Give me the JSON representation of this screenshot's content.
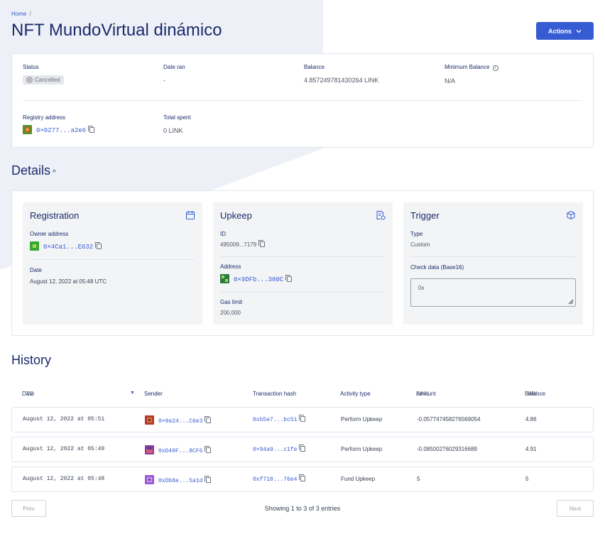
{
  "breadcrumb": {
    "home": "Home",
    "sep": "/"
  },
  "page": {
    "title": "NFT MundoVirtual dinámico"
  },
  "actions": {
    "label": "Actions"
  },
  "summary": {
    "status_label": "Status",
    "status_value": "Cancelled",
    "date_ran_label": "Date ran",
    "date_ran_value": "-",
    "balance_label": "Balance",
    "balance_value": "4.857249781430264 LINK",
    "min_balance_label": "Minimum Balance",
    "min_balance_value": "N/A",
    "registry_label": "Registry address",
    "registry_value": "0×0277...a2e6",
    "total_spent_label": "Total spent",
    "total_spent_value": "0 LINK"
  },
  "details": {
    "heading": "Details",
    "registration": {
      "title": "Registration",
      "owner_label": "Owner address",
      "owner_value": "0×4Ca1...E632",
      "date_label": "Date",
      "date_value": "August 12, 2022 at 05:48 UTC"
    },
    "upkeep": {
      "title": "Upkeep",
      "id_label": "ID",
      "id_value": "495009...7179",
      "address_label": "Address",
      "address_value": "0×9DFb...380C",
      "gas_label": "Gas limit",
      "gas_value": "200,000"
    },
    "trigger": {
      "title": "Trigger",
      "type_label": "Type",
      "type_value": "Custom",
      "check_label": "Check data (Base16)",
      "check_value": "0x"
    }
  },
  "history": {
    "heading": "History",
    "columns": {
      "date": "Date",
      "date_unit": "UTC",
      "sender": "Sender",
      "tx": "Transaction hash",
      "activity": "Activity type",
      "amount": "Amount",
      "amount_unit": "LINK",
      "balance": "Balance",
      "balance_unit": "LINK"
    },
    "rows": [
      {
        "date": "August 12, 2022 at 05:51",
        "sender": "0×9a24...C6e3",
        "tx": "0xb5e7...bc51",
        "activity": "Perform Upkeep",
        "amount": "-0.057747458276569054",
        "balance": "4.86"
      },
      {
        "date": "August 12, 2022 at 05:49",
        "sender": "0xD49F...8CF6",
        "tx": "0×94a9...c1fe",
        "activity": "Perform Upkeep",
        "amount": "-0.08500276029316689",
        "balance": "4.91"
      },
      {
        "date": "August 12, 2022 at 05:48",
        "sender": "0xDb8e...5a1d",
        "tx": "0xf718...76e4",
        "activity": "Fund Upkeep",
        "amount": "5",
        "balance": "5"
      }
    ],
    "prev": "Prev",
    "next": "Next",
    "showing": "Showing 1 to 3 of 3 entries"
  },
  "colors": {
    "accent": "#375bd2",
    "title": "#1a2b6b",
    "panel_bg": "#f3f4f6",
    "hero_bg": "#eef0f7"
  },
  "icons": [
    "cancel-circle-icon",
    "copy-icon",
    "info-icon",
    "calendar-icon",
    "upkeep-doc-icon",
    "cube-icon",
    "chevron-down-icon",
    "chevron-up-icon",
    "sort-icon"
  ]
}
